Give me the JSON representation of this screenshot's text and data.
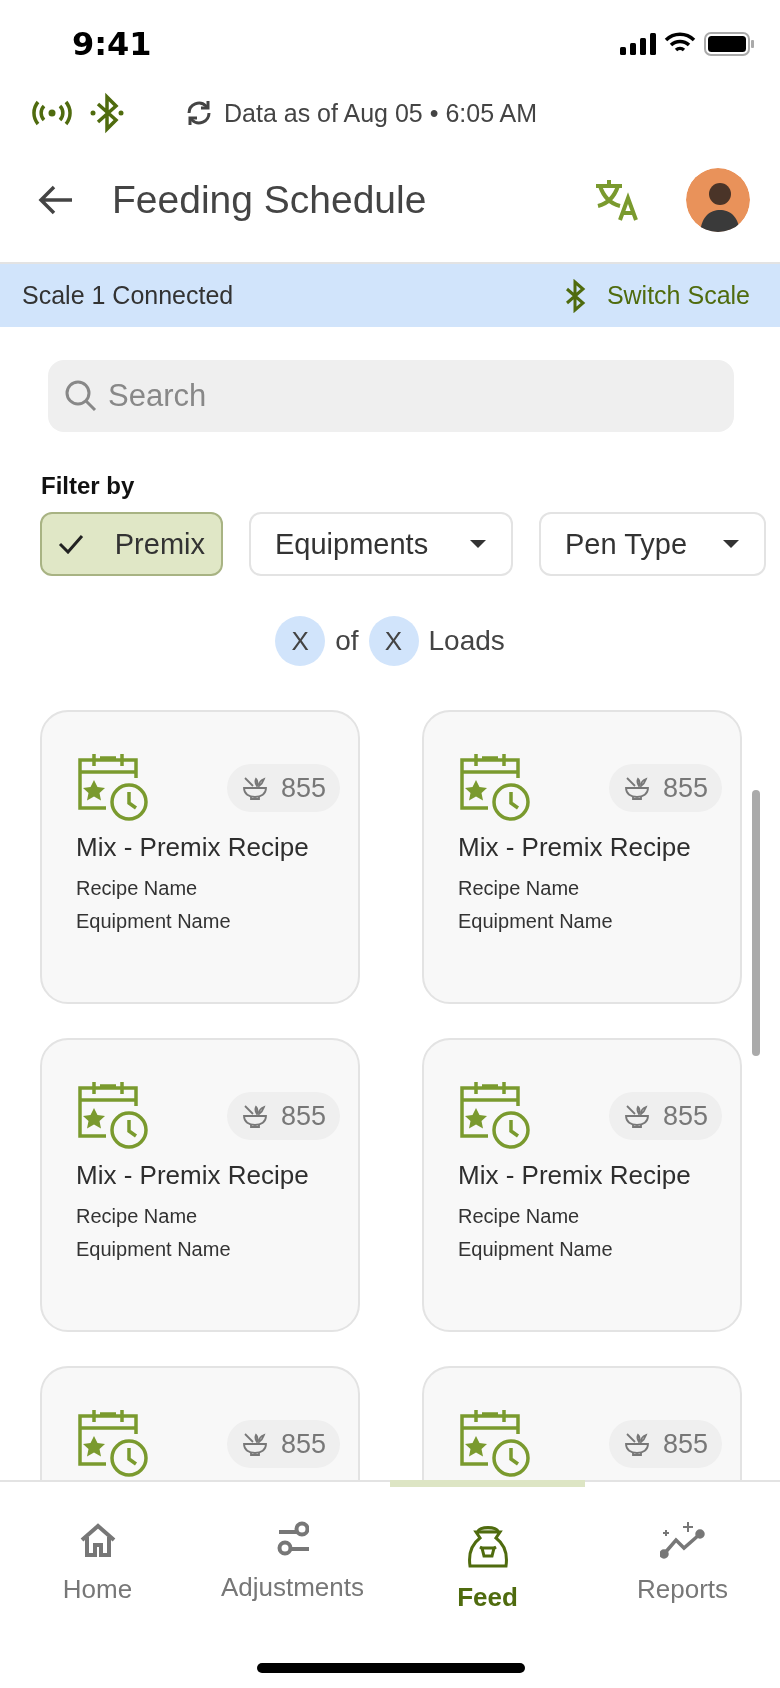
{
  "status_bar": {
    "time": "9:41"
  },
  "info_bar": {
    "sync_text": "Data as of Aug 05 • 6:05 AM"
  },
  "header": {
    "title": "Feeding Schedule"
  },
  "scale_banner": {
    "status": "Scale 1 Connected",
    "action": "Switch Scale"
  },
  "search": {
    "placeholder": "Search"
  },
  "filters": {
    "label": "Filter by",
    "chips": [
      {
        "kind": "toggle",
        "label": "Premix",
        "selected": true
      },
      {
        "kind": "dropdown",
        "label": "Equipments",
        "selected": false
      },
      {
        "kind": "dropdown",
        "label": "Pen Type",
        "selected": false
      }
    ]
  },
  "loads": {
    "current": "X",
    "of": "of",
    "total": "X",
    "unit": "Loads"
  },
  "cards": [
    {
      "count": "855",
      "title": "Mix - Premix Recipe",
      "recipe": "Recipe Name",
      "equipment": "Equipment Name"
    },
    {
      "count": "855",
      "title": "Mix - Premix Recipe",
      "recipe": "Recipe Name",
      "equipment": "Equipment Name"
    },
    {
      "count": "855",
      "title": "Mix - Premix Recipe",
      "recipe": "Recipe Name",
      "equipment": "Equipment Name"
    },
    {
      "count": "855",
      "title": "Mix - Premix Recipe",
      "recipe": "Recipe Name",
      "equipment": "Equipment Name"
    },
    {
      "count": "855"
    },
    {
      "count": "855"
    }
  ],
  "nav": [
    {
      "label": "Home",
      "selected": false
    },
    {
      "label": "Adjustments",
      "selected": false
    },
    {
      "label": "Feed",
      "selected": true
    },
    {
      "label": "Reports",
      "selected": false
    }
  ]
}
